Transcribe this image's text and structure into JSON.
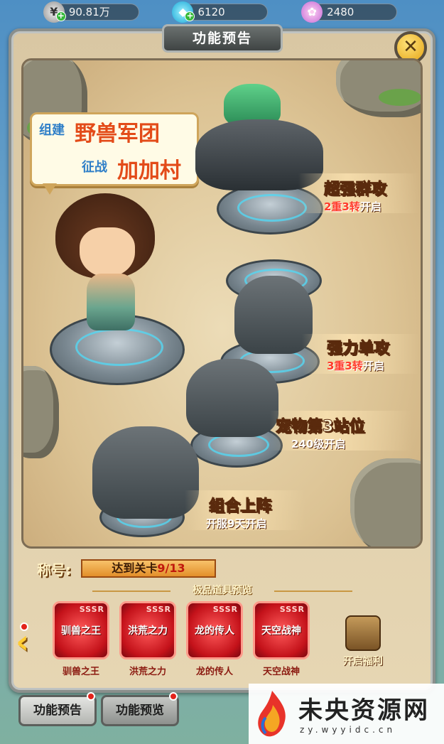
{
  "currencies": [
    {
      "icon": "silver-coin-icon",
      "value": "90.81万"
    },
    {
      "icon": "diamond-icon",
      "value": "6120"
    },
    {
      "icon": "shell-icon",
      "value": "2480"
    }
  ],
  "panel": {
    "title": "功能预告",
    "close_icon": "close-icon"
  },
  "speech": {
    "line1_prefix": "组建",
    "line1_highlight": "野兽军团",
    "line2_prefix": "征战",
    "line2_highlight": "加加村"
  },
  "features": [
    {
      "name": "超强群攻",
      "cond_a": "2重3转",
      "cond_b": "开启"
    },
    {
      "name": "强力单攻",
      "cond_a": "3重3转",
      "cond_b": "开启"
    },
    {
      "name": "宠物第3站位",
      "cond_a": "240级",
      "cond_b": "开启"
    },
    {
      "name": "组合上阵",
      "cond_a": "开服9天",
      "cond_b": "开启"
    }
  ],
  "title_bar": {
    "label": "称号:",
    "value_prefix": "达到关卡",
    "value_progress": "9/13"
  },
  "preview": {
    "heading": "极品道具预览",
    "items": [
      {
        "rarity": "SSSR",
        "card_name": "驯兽之王",
        "label": "驯兽之王"
      },
      {
        "rarity": "SSSR",
        "card_name": "洪荒之力",
        "label": "洪荒之力"
      },
      {
        "rarity": "SSSR",
        "card_name": "龙的传人",
        "label": "龙的传人"
      },
      {
        "rarity": "SSSR",
        "card_name": "天空战神",
        "label": "天空战神"
      }
    ],
    "reward_label": "开启福利"
  },
  "tabs": [
    {
      "label": "功能预告"
    },
    {
      "label": "功能预览"
    }
  ],
  "watermark": {
    "title": "未央资源网",
    "url": "zy.wyyidc.cn"
  }
}
